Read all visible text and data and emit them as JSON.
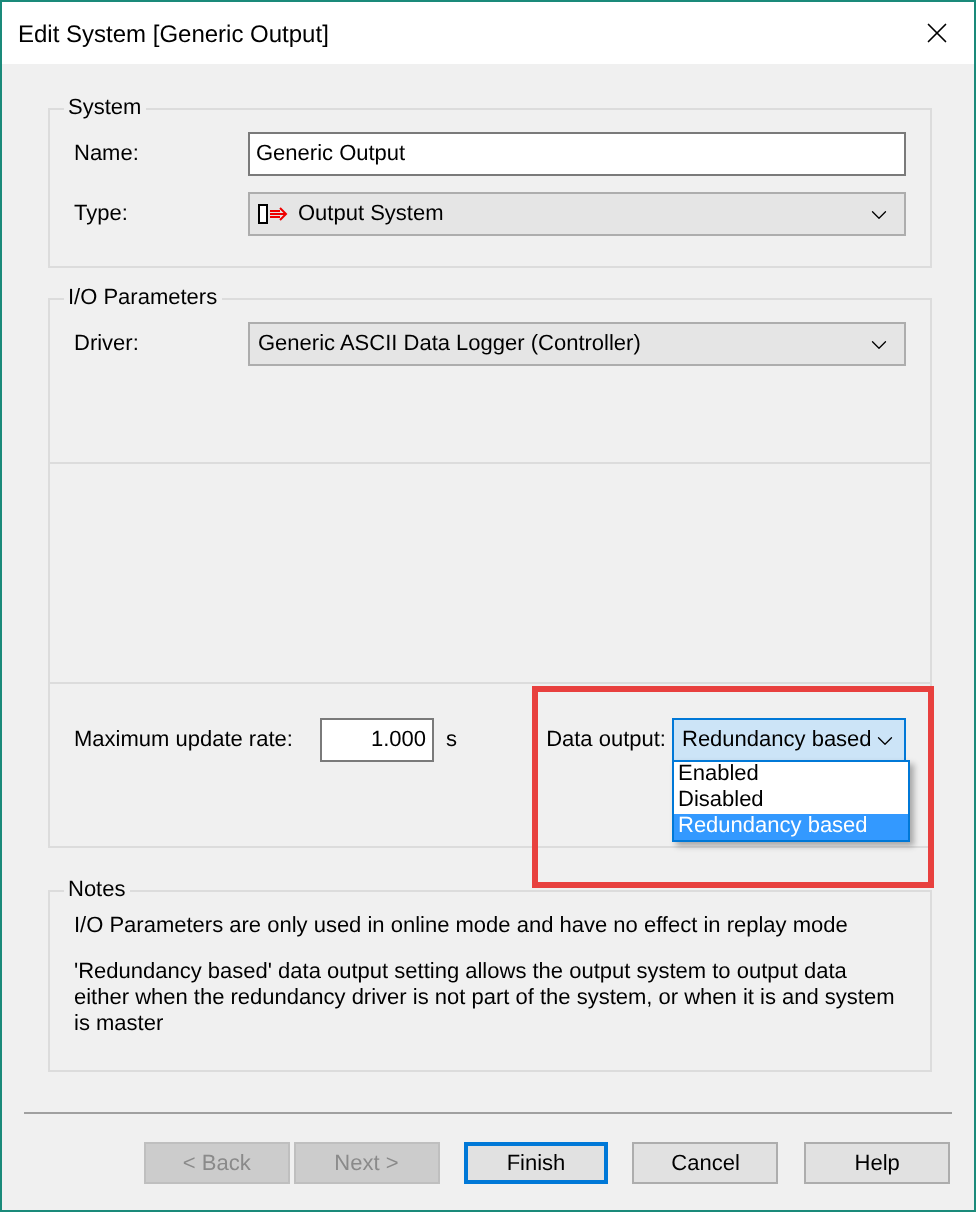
{
  "window": {
    "title": "Edit System [Generic Output]"
  },
  "system": {
    "title": "System",
    "name": {
      "label": "Name:",
      "value": "Generic Output"
    },
    "type": {
      "label": "Type:",
      "value": "Output System"
    }
  },
  "io_parameters": {
    "title": "I/O Parameters",
    "driver": {
      "label": "Driver:",
      "value": "Generic ASCII Data Logger (Controller)"
    },
    "update_rate": {
      "label": "Maximum update rate:",
      "value": "1.000",
      "unit": "s"
    },
    "data_output": {
      "label": "Data output:",
      "value": "Redundancy based",
      "expanded": true,
      "options": [
        {
          "label": "Enabled",
          "selected": false
        },
        {
          "label": "Disabled",
          "selected": false
        },
        {
          "label": "Redundancy based",
          "selected": true
        }
      ]
    }
  },
  "highlight": {
    "visible": true
  },
  "notes": {
    "title": "Notes",
    "paragraphs": [
      "I/O Parameters are only used in online mode and have no effect in replay mode",
      "'Redundancy based' data output setting allows the output system to output data either when the redundancy driver is not part of the system, or when it is and system is master"
    ]
  },
  "buttons": [
    {
      "label": "< Back",
      "disabled": true,
      "default": false
    },
    {
      "label": "Next >",
      "disabled": true,
      "default": false
    },
    {
      "label": "Finish",
      "disabled": false,
      "default": true
    },
    {
      "label": "Cancel",
      "disabled": false,
      "default": false
    },
    {
      "label": "Help",
      "disabled": false,
      "default": false
    }
  ]
}
